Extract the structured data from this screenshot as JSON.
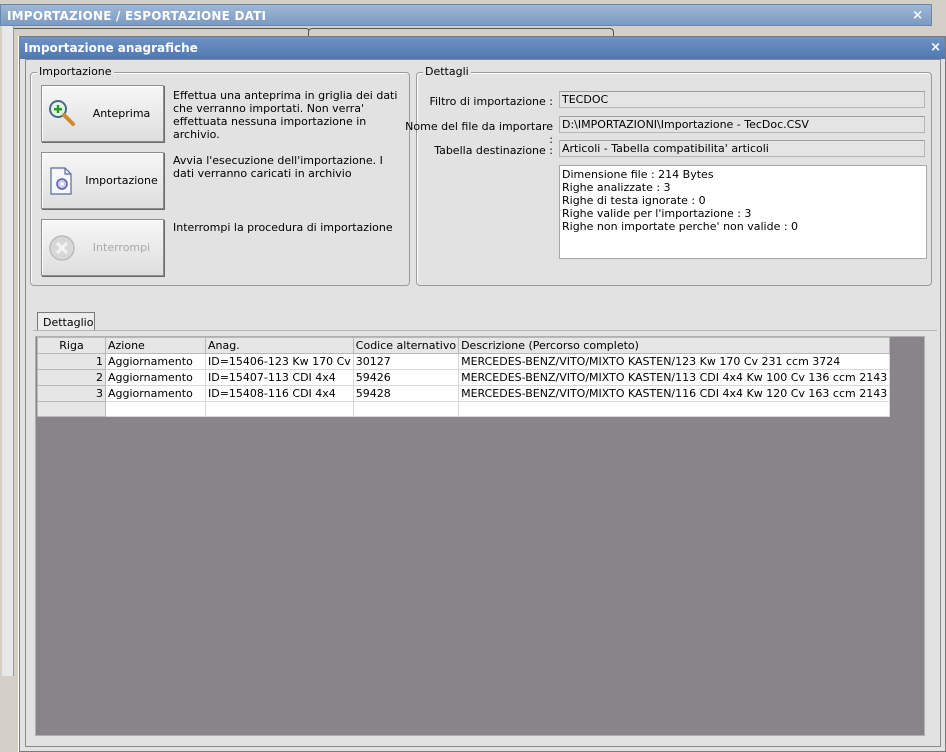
{
  "outer_window": {
    "title": "IMPORTAZIONE / ESPORTAZIONE DATI",
    "close_glyph": "×"
  },
  "dialog": {
    "title": "Importazione anagrafiche",
    "close_glyph": "×"
  },
  "import_group": {
    "legend": "Importazione",
    "buttons": [
      {
        "label": "Anteprima",
        "icon": "magnifier-plus-icon",
        "description": "Effettua una anteprima in griglia dei dati che verranno importati. Non verra' effettuata nessuna importazione in archivio."
      },
      {
        "label": "Importazione",
        "icon": "document-gear-icon",
        "description": "Avvia l'esecuzione dell'importazione. I dati verranno caricati in archivio"
      },
      {
        "label": "Interrompi",
        "icon": "stop-x-icon",
        "description": "Interrompi la procedura di importazione",
        "disabled": true
      }
    ]
  },
  "details_group": {
    "legend": "Dettagli",
    "filter_label": "Filtro di importazione :",
    "filter_value": "TECDOC",
    "file_label": "Nome del file da importare :",
    "file_value": "D:\\IMPORTAZIONI\\Importazione - TecDoc.CSV",
    "table_label": "Tabella destinazione :",
    "table_value": "Articoli - Tabella compatibilita' articoli",
    "info_lines": [
      "Dimensione file : 214 Bytes",
      "Righe analizzate : 3",
      "Righe di testa ignorate : 0",
      "Righe valide per l'importazione : 3",
      "Righe non importate perche' non valide : 0"
    ]
  },
  "detail_tab": {
    "label": "Dettaglio"
  },
  "grid": {
    "columns": [
      "Riga",
      "Azione",
      "Anag.",
      "Codice alternativo",
      "Descrizione (Percorso completo)"
    ],
    "rows": [
      {
        "riga": "1",
        "azione": "Aggiornamento",
        "anag": "ID=15406-123 Kw 170 Cv",
        "codice": "30127",
        "descrizione": "MERCEDES-BENZ/VITO/MIXTO KASTEN/123 Kw 170 Cv 231 ccm 3724"
      },
      {
        "riga": "2",
        "azione": "Aggiornamento",
        "anag": "ID=15407-113 CDI 4x4",
        "codice": "59426",
        "descrizione": "MERCEDES-BENZ/VITO/MIXTO KASTEN/113 CDI 4x4 Kw 100 Cv 136 ccm 2143"
      },
      {
        "riga": "3",
        "azione": "Aggiornamento",
        "anag": "ID=15408-116 CDI 4x4",
        "codice": "59428",
        "descrizione": "MERCEDES-BENZ/VITO/MIXTO KASTEN/116 CDI 4x4 Kw 120 Cv 163 ccm 2143"
      }
    ]
  },
  "colors": {
    "title_bar": "#5078b0",
    "grid_background": "#878587",
    "dialog_background": "#e2e2e2"
  }
}
